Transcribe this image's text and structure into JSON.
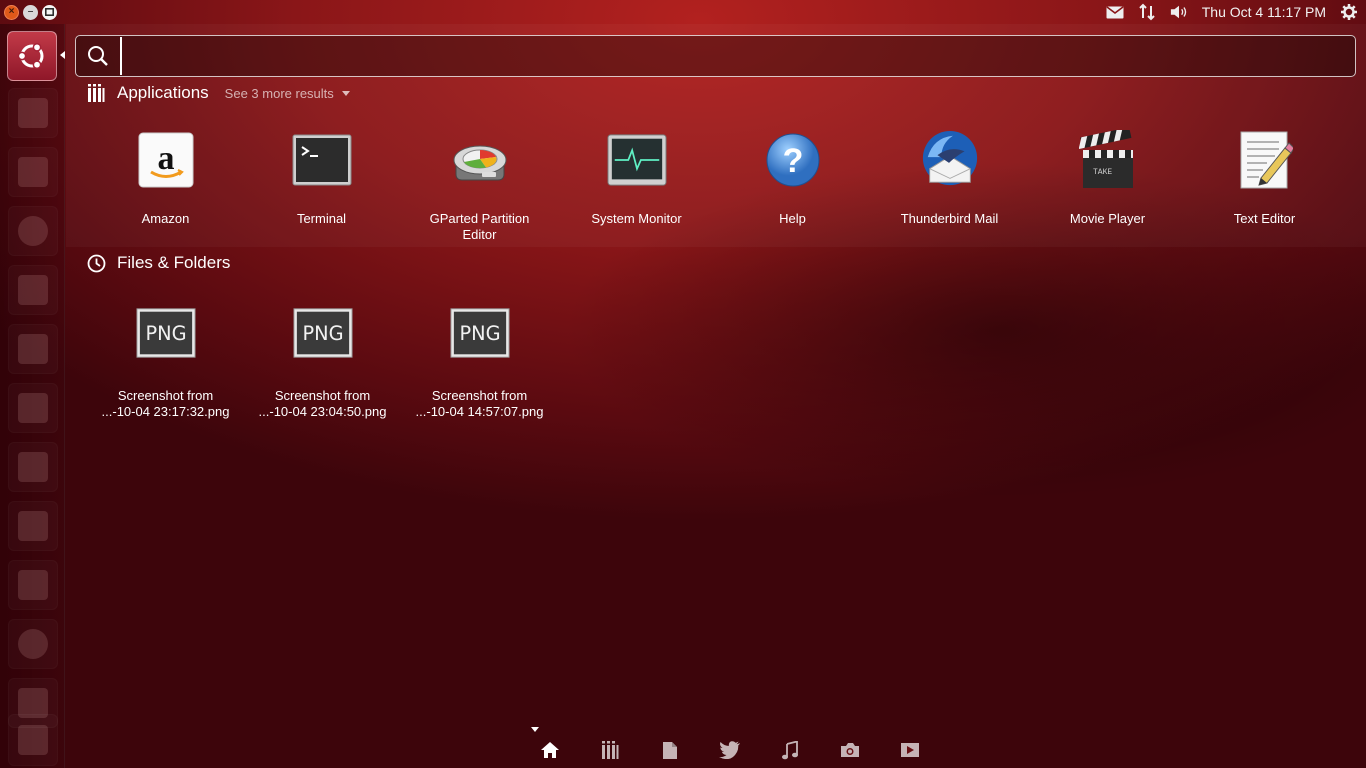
{
  "panel": {
    "clock": "Thu Oct  4 11:17 PM",
    "window_controls": [
      "close-icon",
      "minimize-icon",
      "maximize-icon"
    ],
    "indicators": [
      "mail-icon",
      "network-icon",
      "volume-icon",
      "power-gear-icon"
    ]
  },
  "search": {
    "value": "",
    "placeholder": ""
  },
  "applications": {
    "title": "Applications",
    "see_more": "See 3 more results",
    "items": [
      {
        "label": "Amazon",
        "icon": "amazon-icon"
      },
      {
        "label": "Terminal",
        "icon": "terminal-icon"
      },
      {
        "label": "GParted Partition Editor",
        "icon": "gparted-icon"
      },
      {
        "label": "System Monitor",
        "icon": "system-monitor-icon"
      },
      {
        "label": "Help",
        "icon": "help-icon"
      },
      {
        "label": "Thunderbird Mail",
        "icon": "thunderbird-icon"
      },
      {
        "label": "Movie Player",
        "icon": "movie-player-icon"
      },
      {
        "label": "Text Editor",
        "icon": "text-editor-icon"
      }
    ]
  },
  "files": {
    "title": "Files & Folders",
    "items": [
      {
        "line1": "Screenshot from",
        "line2": "...-10-04 23:17:32.png",
        "badge": "PNG"
      },
      {
        "line1": "Screenshot from",
        "line2": "...-10-04 23:04:50.png",
        "badge": "PNG"
      },
      {
        "line1": "Screenshot from",
        "line2": "...-10-04 14:57:07.png",
        "badge": "PNG"
      }
    ]
  },
  "lenses": [
    "home-lens-icon",
    "applications-lens-icon",
    "files-lens-icon",
    "social-lens-icon",
    "music-lens-icon",
    "photos-lens-icon",
    "video-lens-icon"
  ],
  "colors": {
    "accent": "#b2211f",
    "bfb": "#c23a48",
    "amazon_orange": "#f29b1d"
  }
}
